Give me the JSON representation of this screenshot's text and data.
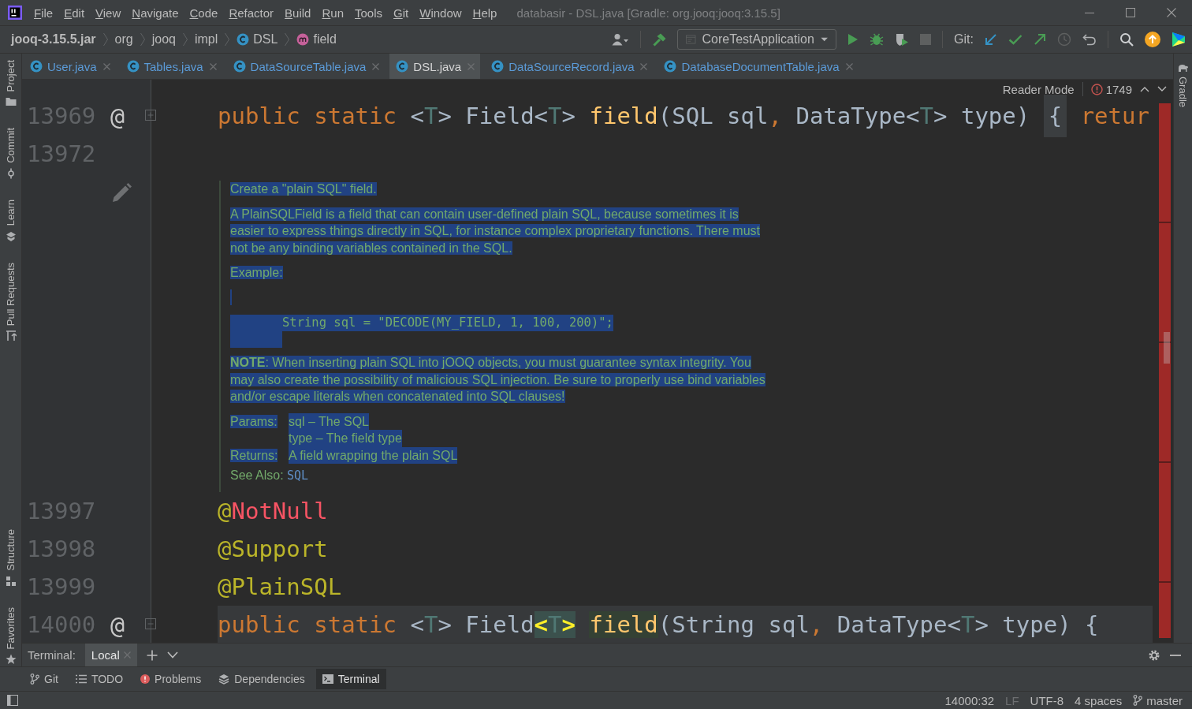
{
  "menu": [
    "File",
    "Edit",
    "View",
    "Navigate",
    "Code",
    "Refactor",
    "Build",
    "Run",
    "Tools",
    "Git",
    "Window",
    "Help"
  ],
  "window_title": "databasir - DSL.java [Gradle: org.jooq:jooq:3.15.5]",
  "breadcrumbs": [
    {
      "label": "jooq-3.15.5.jar",
      "kind": "jar"
    },
    {
      "label": "org",
      "kind": "package"
    },
    {
      "label": "jooq",
      "kind": "package"
    },
    {
      "label": "impl",
      "kind": "package"
    },
    {
      "label": "DSL",
      "kind": "class"
    },
    {
      "label": "field",
      "kind": "method"
    }
  ],
  "run_config": "CoreTestApplication",
  "git_label": "Git:",
  "left_tools": {
    "top": [
      {
        "label": "Project",
        "kind": "project"
      },
      {
        "label": "Commit",
        "kind": "commit"
      },
      {
        "label": "Learn",
        "kind": "learn"
      },
      {
        "label": "Pull Requests",
        "kind": "pull_requests"
      }
    ],
    "bottom": [
      {
        "label": "Structure",
        "kind": "structure"
      },
      {
        "label": "Favorites",
        "kind": "favorites"
      }
    ]
  },
  "right_tools": [
    {
      "label": "Gradle",
      "kind": "gradle"
    }
  ],
  "tabs": [
    {
      "label": "User.java",
      "selected": false
    },
    {
      "label": "Tables.java",
      "selected": false
    },
    {
      "label": "DataSourceTable.java",
      "selected": false
    },
    {
      "label": "DSL.java",
      "selected": true
    },
    {
      "label": "DataSourceRecord.java",
      "selected": false
    },
    {
      "label": "DatabaseDocumentTable.java",
      "selected": false
    }
  ],
  "editor": {
    "reader_mode": "Reader Mode",
    "problems": "1749",
    "lines_before": [
      {
        "number": "13969",
        "marker": "@",
        "kind": "collapsed",
        "current": false,
        "tokens": [
          {
            "text": "public static ",
            "kind": "keyword"
          },
          {
            "text": "<",
            "kind": "plain"
          },
          {
            "text": "T",
            "kind": "typeparam"
          },
          {
            "text": "> Field<",
            "kind": "plain"
          },
          {
            "text": "T",
            "kind": "typeparam"
          },
          {
            "text": "> ",
            "kind": "plain"
          },
          {
            "text": "field",
            "kind": "method"
          },
          {
            "text": "(SQL sql",
            "kind": "plain"
          },
          {
            "text": ",",
            "kind": "keyword"
          },
          {
            "text": " DataType<",
            "kind": "plain"
          },
          {
            "text": "T",
            "kind": "typeparam"
          },
          {
            "text": "> type) ",
            "kind": "plain"
          },
          {
            "text": "{",
            "kind": "folded"
          },
          {
            "text": " retur",
            "kind": "keyword"
          }
        ]
      },
      {
        "number": "13972",
        "kind": "plain",
        "current": false
      }
    ],
    "doc": {
      "selected": true,
      "summary": "Create a \"plain SQL\" field.",
      "description": "A PlainSQLField is a field that can contain user-defined plain SQL, because sometimes it is easier to express things directly in SQL, for instance complex proprietary functions. There must not be any binding variables contained in the SQL.",
      "example_label": "Example:",
      "example_code": "String sql = \"DECODE(MY_FIELD, 1, 100, 200)\";",
      "note": "**NOTE**: When inserting plain SQL into jOOQ objects, you must guarantee syntax integrity. You may also create the possibility of malicious SQL injection. Be sure to properly use bind variables and/or escape literals when concatenated into SQL clauses!",
      "params_label": "Params:",
      "params": [
        "sql – The SQL",
        "type – The field type"
      ],
      "returns_label": "Returns:",
      "returns": "A field wrapping the plain SQL",
      "see_also_label": "See Also:",
      "see_also": "SQL"
    },
    "lines_after": [
      {
        "number": "13997",
        "kind": "block_end",
        "current": false,
        "tokens": [
          {
            "text": "@",
            "kind": "annotation"
          },
          {
            "text": "NotNull",
            "kind": "unresolved"
          }
        ]
      },
      {
        "number": "13998",
        "kind": "plain",
        "current": false,
        "tokens": [
          {
            "text": "@Support",
            "kind": "annotation"
          }
        ]
      },
      {
        "number": "13999",
        "kind": "block_start",
        "current": false,
        "tokens": [
          {
            "text": "@PlainSQL",
            "kind": "annotation"
          }
        ]
      },
      {
        "number": "14000",
        "marker": "@",
        "kind": "expanded",
        "current": true,
        "tokens": [
          {
            "text": "public static ",
            "kind": "keyword"
          },
          {
            "text": "<",
            "kind": "plain"
          },
          {
            "text": "T",
            "kind": "typeparam"
          },
          {
            "text": "> Field",
            "kind": "plain"
          },
          {
            "text": "<",
            "kind": "brace_match"
          },
          {
            "text": "T",
            "kind": "typeparam_occurrence"
          },
          {
            "text": ">",
            "kind": "brace_match"
          },
          {
            "text": " field",
            "kind": "method_occurrence"
          },
          {
            "text": "(String sql",
            "kind": "plain"
          },
          {
            "text": ",",
            "kind": "keyword"
          },
          {
            "text": " DataType<",
            "kind": "plain"
          },
          {
            "text": "T",
            "kind": "typeparam"
          },
          {
            "text": "> type) {",
            "kind": "plain"
          }
        ]
      }
    ]
  },
  "terminal": {
    "title": "Terminal:",
    "tabs": [
      {
        "label": "Local",
        "selected": true
      }
    ]
  },
  "tool_tabs": [
    {
      "label": "Git",
      "kind": "git",
      "selected": false
    },
    {
      "label": "TODO",
      "kind": "todo",
      "selected": false
    },
    {
      "label": "Problems",
      "kind": "problems",
      "selected": false
    },
    {
      "label": "Dependencies",
      "kind": "dependencies",
      "selected": false
    },
    {
      "label": "Terminal",
      "kind": "terminal",
      "selected": true
    }
  ],
  "status": {
    "position": "14000:32",
    "line_separator": "LF",
    "encoding": "UTF-8",
    "indent": "4 spaces",
    "branch": "master"
  }
}
